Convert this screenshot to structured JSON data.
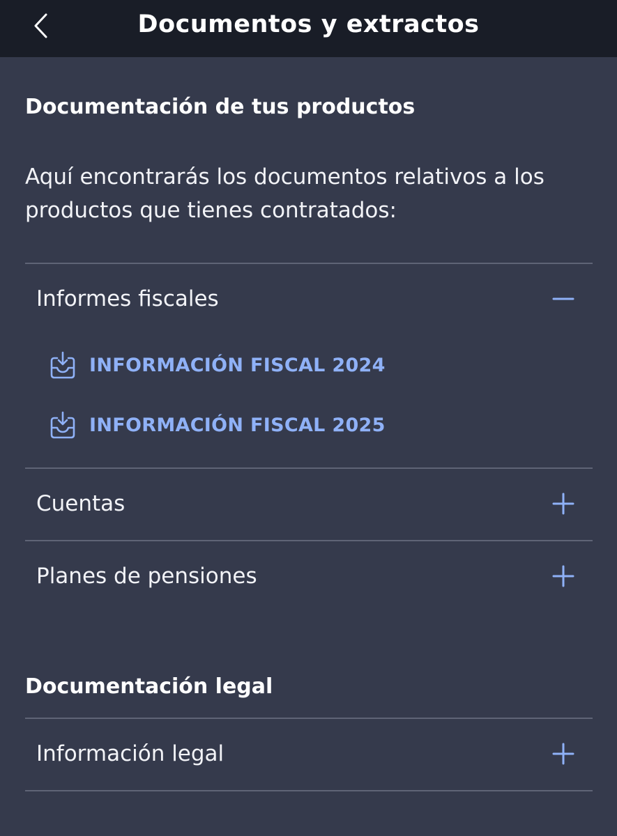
{
  "header": {
    "title": "Documentos y extractos",
    "back_icon": "chevron-left-icon"
  },
  "products_section": {
    "title": "Documentación de tus productos",
    "intro": "Aquí encontrarás los documentos relativos a los productos que tienes contratados:"
  },
  "accordions": [
    {
      "label": "Informes fiscales",
      "expanded": true,
      "toggle_icon": "minus-icon",
      "links": [
        {
          "label": "INFORMACIÓN FISCAL 2024",
          "icon": "download-tray-icon"
        },
        {
          "label": "INFORMACIÓN FISCAL 2025",
          "icon": "download-tray-icon"
        }
      ]
    },
    {
      "label": "Cuentas",
      "expanded": false,
      "toggle_icon": "plus-icon"
    },
    {
      "label": "Planes de pensiones",
      "expanded": false,
      "toggle_icon": "plus-icon"
    }
  ],
  "legal_section": {
    "title": "Documentación legal",
    "accordions": [
      {
        "label": "Información legal",
        "expanded": false,
        "toggle_icon": "plus-icon"
      }
    ]
  },
  "colors": {
    "header_bg": "#191d27",
    "page_bg": "#353a4c",
    "accent": "#8fb1f7",
    "divider": "#5f6476",
    "text": "#ffffff"
  }
}
